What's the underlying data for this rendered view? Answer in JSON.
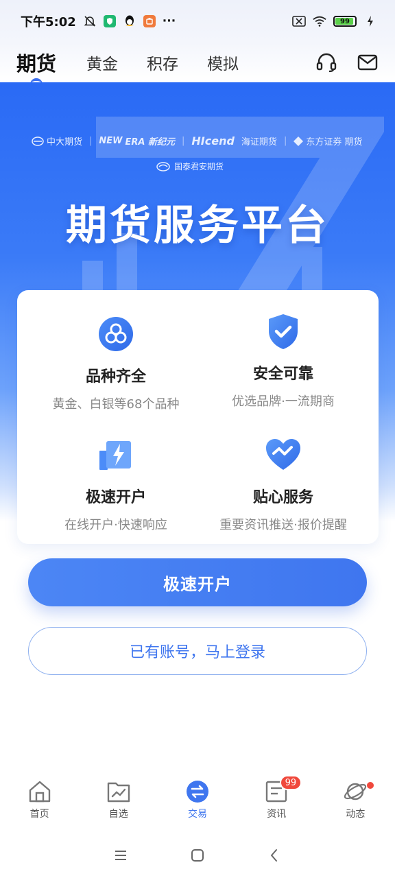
{
  "status_bar": {
    "time": "下午5:02",
    "more": "···",
    "battery": "99"
  },
  "top_nav": {
    "tabs": [
      {
        "label": "期货",
        "active": true
      },
      {
        "label": "黄金",
        "active": false
      },
      {
        "label": "积存",
        "active": false
      },
      {
        "label": "模拟",
        "active": false
      }
    ]
  },
  "hero": {
    "partners": {
      "p1": "中大期货",
      "p2_a": "NEW",
      "p2_b": "ERA 新纪元",
      "p3": "HIcend",
      "p3_cn": "海证期货",
      "p4": "东方证券",
      "p5": "期货",
      "p6": "国泰君安期货"
    },
    "title": "期货服务平台"
  },
  "features": [
    {
      "title": "品种齐全",
      "desc": "黄金、白银等68个品种",
      "icon": "variety-icon"
    },
    {
      "title": "安全可靠",
      "desc": "优选品牌·一流期商",
      "icon": "shield-check-icon"
    },
    {
      "title": "极速开户",
      "desc": "在线开户·快速响应",
      "icon": "lightning-icon"
    },
    {
      "title": "贴心服务",
      "desc": "重要资讯推送·报价提醒",
      "icon": "heart-trend-icon"
    }
  ],
  "actions": {
    "open_account": "极速开户",
    "login": "已有账号，马上登录"
  },
  "bottom_tabs": [
    {
      "label": "首页",
      "icon": "home-icon"
    },
    {
      "label": "自选",
      "icon": "watchlist-icon"
    },
    {
      "label": "交易",
      "icon": "trade-icon",
      "active": true
    },
    {
      "label": "资讯",
      "icon": "news-icon",
      "badge": "99"
    },
    {
      "label": "动态",
      "icon": "planet-icon",
      "dot": true
    }
  ],
  "colors": {
    "accent": "#3f76ef",
    "hero_top": "#2a6af5",
    "badge": "#f0483c"
  }
}
